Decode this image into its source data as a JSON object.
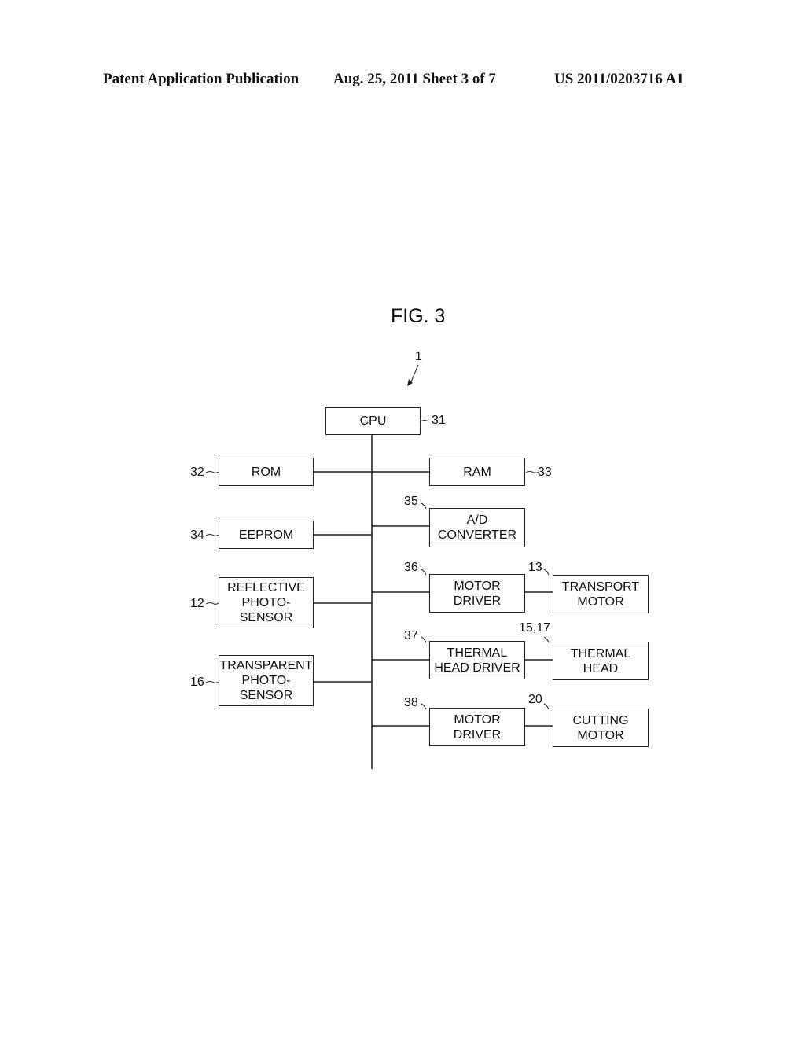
{
  "header": {
    "publication": "Patent Application Publication",
    "date_sheet": "Aug. 25, 2011  Sheet 3 of 7",
    "number": "US 2011/0203716 A1"
  },
  "figure": {
    "title": "FIG. 3",
    "device_ref": "1",
    "blocks": {
      "cpu": {
        "label": "CPU",
        "ref": "31"
      },
      "rom": {
        "label": "ROM",
        "ref": "32"
      },
      "ram": {
        "label": "RAM",
        "ref": "33"
      },
      "eeprom": {
        "label": "EEPROM",
        "ref": "34"
      },
      "adc": {
        "label": "A/D\nCONVERTER",
        "ref": "35"
      },
      "motor_driver_1": {
        "label": "MOTOR\nDRIVER",
        "ref": "36"
      },
      "transport_motor": {
        "label": "TRANSPORT\nMOTOR",
        "ref": "13"
      },
      "reflective_sensor": {
        "label": "REFLECTIVE\nPHOTO-\nSENSOR",
        "ref": "12"
      },
      "thermal_head_driver": {
        "label": "THERMAL\nHEAD DRIVER",
        "ref": "37"
      },
      "thermal_head": {
        "label": "THERMAL\nHEAD",
        "ref": "15,17"
      },
      "transparent_sensor": {
        "label": "TRANSPARENT\nPHOTO-\nSENSOR",
        "ref": "16"
      },
      "motor_driver_2": {
        "label": "MOTOR\nDRIVER",
        "ref": "38"
      },
      "cutting_motor": {
        "label": "CUTTING\nMOTOR",
        "ref": "20"
      }
    }
  }
}
